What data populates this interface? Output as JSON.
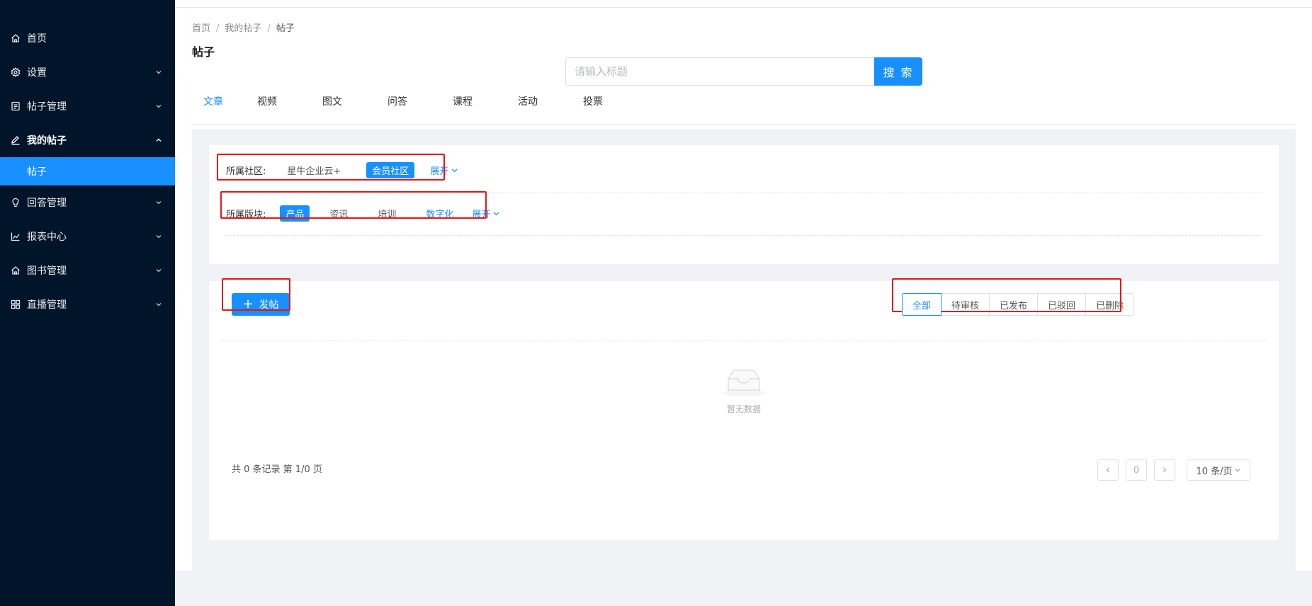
{
  "sidebar": {
    "items": [
      {
        "label": "首页",
        "icon": "home-icon"
      },
      {
        "label": "设置",
        "icon": "gear-icon"
      },
      {
        "label": "帖子管理",
        "icon": "document-icon"
      },
      {
        "label": "我的帖子",
        "icon": "edit-icon"
      },
      {
        "label": "回答管理",
        "icon": "lightbulb-icon"
      },
      {
        "label": "报表中心",
        "icon": "chart-icon"
      },
      {
        "label": "图书管理",
        "icon": "home-icon"
      },
      {
        "label": "直播管理",
        "icon": "grid-icon"
      }
    ],
    "active_sub": "帖子"
  },
  "breadcrumb": [
    "首页",
    "我的帖子",
    "帖子"
  ],
  "page_title": "帖子",
  "search": {
    "placeholder": "请输入标题",
    "button": "搜 索"
  },
  "tabs": [
    "文章",
    "视频",
    "图文",
    "问答",
    "课程",
    "活动",
    "投票"
  ],
  "filters": {
    "community": {
      "label": "所属社区:",
      "options": [
        "星牛企业云+",
        "会员社区"
      ],
      "selected": "会员社区",
      "expand": "展开"
    },
    "section": {
      "label": "所属版块:",
      "options": [
        "产品",
        "资讯",
        "培训",
        "数字化"
      ],
      "selected": "产品",
      "expand": "展开"
    }
  },
  "actions": {
    "post_button": "发帖"
  },
  "status_filters": [
    "全部",
    "待审核",
    "已发布",
    "已驳回",
    "已删除"
  ],
  "empty_text": "暂无数据",
  "pagination": {
    "summary": "共 0 条记录 第 1/0 页",
    "current_page": "0",
    "page_size": "10 条/页"
  },
  "colors": {
    "primary": "#1890ff",
    "sidebar_bg": "#001529",
    "highlight": "#e5161a"
  }
}
